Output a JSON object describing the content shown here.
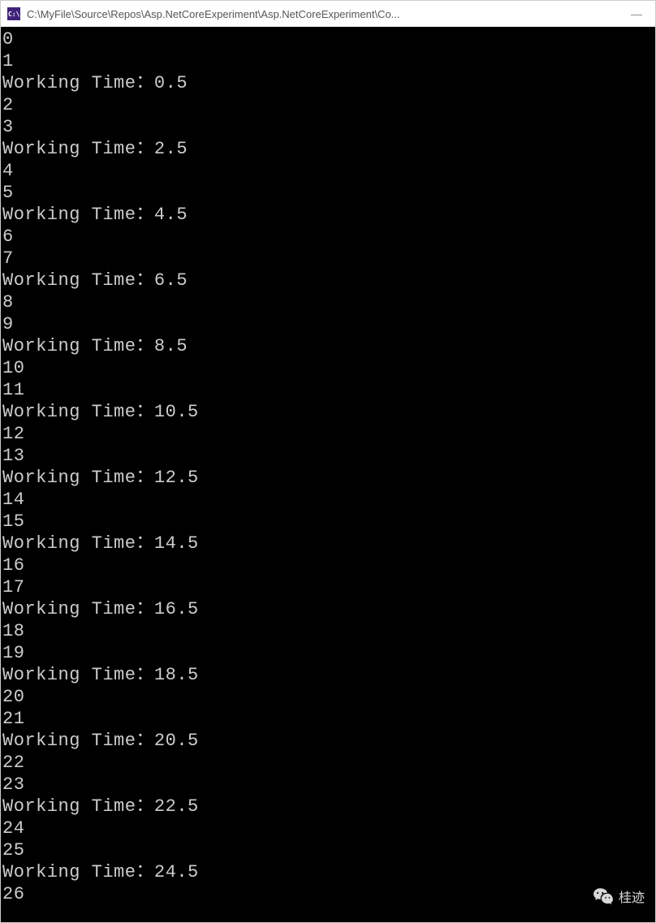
{
  "titlebar": {
    "icon_bg": "#40237a",
    "icon_text": "C:\\",
    "title": "C:\\MyFile\\Source\\Repos\\Asp.NetCoreExperiment\\Asp.NetCoreExperiment\\Co...",
    "minimize": "—"
  },
  "console": {
    "lines": [
      "0",
      "1",
      "Working Time：0.5",
      "2",
      "3",
      "Working Time：2.5",
      "4",
      "5",
      "Working Time：4.5",
      "6",
      "7",
      "Working Time：6.5",
      "8",
      "9",
      "Working Time：8.5",
      "10",
      "11",
      "Working Time：10.5",
      "12",
      "13",
      "Working Time：12.5",
      "14",
      "15",
      "Working Time：14.5",
      "16",
      "17",
      "Working Time：16.5",
      "18",
      "19",
      "Working Time：18.5",
      "20",
      "21",
      "Working Time：20.5",
      "22",
      "23",
      "Working Time：22.5",
      "24",
      "25",
      "Working Time：24.5",
      "26"
    ]
  },
  "watermark": {
    "text": "桂迹"
  }
}
